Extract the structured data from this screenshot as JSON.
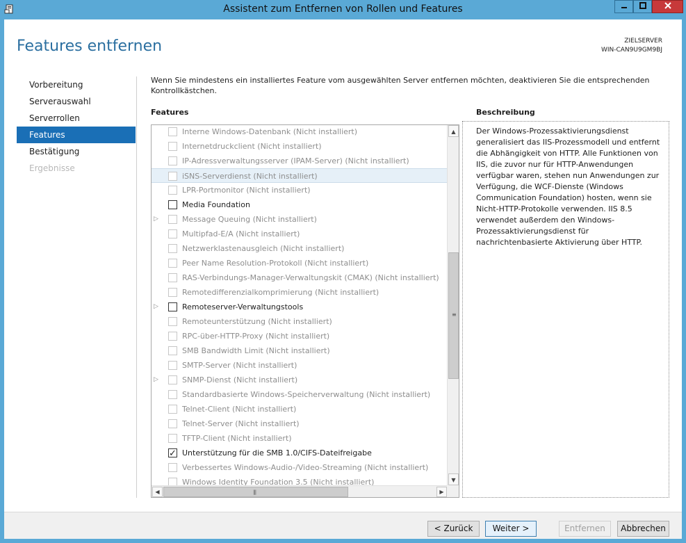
{
  "window": {
    "title": "Assistent zum Entfernen von Rollen und Features"
  },
  "page": {
    "title": "Features entfernen",
    "target_label": "ZIELSERVER",
    "target_server": "WIN-CAN9U9GM9BJ"
  },
  "nav": {
    "items": [
      {
        "label": "Vorbereitung",
        "state": "normal"
      },
      {
        "label": "Serverauswahl",
        "state": "normal"
      },
      {
        "label": "Serverrollen",
        "state": "normal"
      },
      {
        "label": "Features",
        "state": "active"
      },
      {
        "label": "Bestätigung",
        "state": "normal"
      },
      {
        "label": "Ergebnisse",
        "state": "disabled"
      }
    ]
  },
  "content": {
    "intro": "Wenn Sie mindestens ein installiertes Feature vom ausgewählten Server entfernen möchten, deaktivieren Sie die entsprechenden Kontrollkästchen.",
    "features_heading": "Features",
    "description_heading": "Beschreibung",
    "description": "Der Windows-Prozessaktivierungsdienst generalisiert das IIS-Prozessmodell und entfernt die Abhängigkeit von HTTP. Alle Funktionen von IIS, die zuvor nur für HTTP-Anwendungen verfügbar waren, stehen nun Anwendungen zur Verfügung, die WCF-Dienste (Windows Communication Foundation) hosten, wenn sie Nicht-HTTP-Protokolle verwenden. IIS 8.5 verwendet außerdem den Windows-Prozessaktivierungsdienst für nachrichtenbasierte Aktivierung über HTTP."
  },
  "features": [
    {
      "label": "Interne Windows-Datenbank (Nicht installiert)",
      "enabled": false,
      "checked": false,
      "expandable": false,
      "selected": false
    },
    {
      "label": "Internetdruckclient (Nicht installiert)",
      "enabled": false,
      "checked": false,
      "expandable": false,
      "selected": false
    },
    {
      "label": "IP-Adressverwaltungsserver (IPAM-Server) (Nicht installiert)",
      "enabled": false,
      "checked": false,
      "expandable": false,
      "selected": false
    },
    {
      "label": "iSNS-Serverdienst (Nicht installiert)",
      "enabled": false,
      "checked": false,
      "expandable": false,
      "selected": true
    },
    {
      "label": "LPR-Portmonitor (Nicht installiert)",
      "enabled": false,
      "checked": false,
      "expandable": false,
      "selected": false
    },
    {
      "label": "Media Foundation",
      "enabled": true,
      "checked": false,
      "expandable": false,
      "selected": false
    },
    {
      "label": "Message Queuing (Nicht installiert)",
      "enabled": false,
      "checked": false,
      "expandable": true,
      "selected": false
    },
    {
      "label": "Multipfad-E/A (Nicht installiert)",
      "enabled": false,
      "checked": false,
      "expandable": false,
      "selected": false
    },
    {
      "label": "Netzwerklastenausgleich (Nicht installiert)",
      "enabled": false,
      "checked": false,
      "expandable": false,
      "selected": false
    },
    {
      "label": "Peer Name Resolution-Protokoll (Nicht installiert)",
      "enabled": false,
      "checked": false,
      "expandable": false,
      "selected": false
    },
    {
      "label": "RAS-Verbindungs-Manager-Verwaltungskit (CMAK) (Nicht installiert)",
      "enabled": false,
      "checked": false,
      "expandable": false,
      "selected": false
    },
    {
      "label": "Remotedifferenzialkomprimierung (Nicht installiert)",
      "enabled": false,
      "checked": false,
      "expandable": false,
      "selected": false
    },
    {
      "label": "Remoteserver-Verwaltungstools",
      "enabled": true,
      "checked": false,
      "expandable": true,
      "selected": false
    },
    {
      "label": "Remoteunterstützung (Nicht installiert)",
      "enabled": false,
      "checked": false,
      "expandable": false,
      "selected": false
    },
    {
      "label": "RPC-über-HTTP-Proxy (Nicht installiert)",
      "enabled": false,
      "checked": false,
      "expandable": false,
      "selected": false
    },
    {
      "label": "SMB Bandwidth Limit (Nicht installiert)",
      "enabled": false,
      "checked": false,
      "expandable": false,
      "selected": false
    },
    {
      "label": "SMTP-Server (Nicht installiert)",
      "enabled": false,
      "checked": false,
      "expandable": false,
      "selected": false
    },
    {
      "label": "SNMP-Dienst (Nicht installiert)",
      "enabled": false,
      "checked": false,
      "expandable": true,
      "selected": false
    },
    {
      "label": "Standardbasierte Windows-Speicherverwaltung (Nicht installiert)",
      "enabled": false,
      "checked": false,
      "expandable": false,
      "selected": false
    },
    {
      "label": "Telnet-Client (Nicht installiert)",
      "enabled": false,
      "checked": false,
      "expandable": false,
      "selected": false
    },
    {
      "label": "Telnet-Server (Nicht installiert)",
      "enabled": false,
      "checked": false,
      "expandable": false,
      "selected": false
    },
    {
      "label": "TFTP-Client (Nicht installiert)",
      "enabled": false,
      "checked": false,
      "expandable": false,
      "selected": false
    },
    {
      "label": "Unterstützung für die SMB 1.0/CIFS-Dateifreigabe",
      "enabled": true,
      "checked": true,
      "expandable": false,
      "selected": false
    },
    {
      "label": "Verbessertes Windows-Audio-/Video-Streaming (Nicht installiert)",
      "enabled": false,
      "checked": false,
      "expandable": false,
      "selected": false
    },
    {
      "label": "Windows Identity Foundation 3.5 (Nicht installiert)",
      "enabled": false,
      "checked": false,
      "expandable": false,
      "selected": false
    }
  ],
  "buttons": {
    "back": "< Zurück",
    "next": "Weiter >",
    "remove": "Entfernen",
    "cancel": "Abbrechen"
  },
  "colors": {
    "titlebar": "#5aa9d6",
    "accent": "#1a6fb6",
    "page_title": "#2b6fa0",
    "close": "#c7393a"
  },
  "icons": {
    "app": "server-manager-icon",
    "minimize": "minimize-icon",
    "maximize": "maximize-icon",
    "close": "close-icon"
  }
}
